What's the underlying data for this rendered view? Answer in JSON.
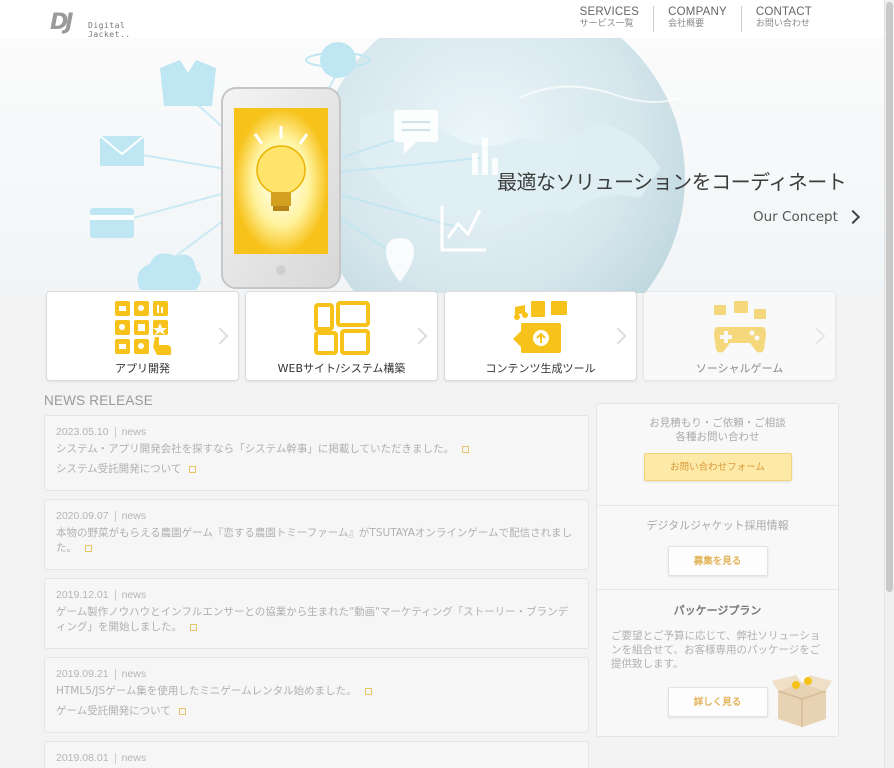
{
  "header": {
    "logo_mark": "DJ",
    "logo_text": "Digital Jacket..",
    "nav": [
      {
        "en": "SERVICES",
        "jp": "サービス一覧"
      },
      {
        "en": "COMPANY",
        "jp": "会社概要"
      },
      {
        "en": "CONTACT",
        "jp": "お問い合わせ"
      }
    ]
  },
  "hero": {
    "tagline": "最適なソリューションをコーディネート",
    "concept_link": "Our Concept"
  },
  "services": [
    {
      "label": "アプリ開発",
      "icon": "apps-grid-icon"
    },
    {
      "label": "WEBサイト/システム構築",
      "icon": "devices-icon"
    },
    {
      "label": "コンテンツ生成ツール",
      "icon": "content-tools-icon"
    },
    {
      "label": "ソーシャルゲーム",
      "icon": "gamepad-icon"
    }
  ],
  "news": {
    "title": "NEWS RELEASE",
    "items": [
      {
        "date": "2023.05.10",
        "category": "news",
        "links": [
          "システム・アプリ開発会社を探すなら「システム幹事」に掲載していただきました。",
          "システム受託開発について"
        ]
      },
      {
        "date": "2020.09.07",
        "category": "news",
        "links": [
          "本物の野菜がもらえる農園ゲーム『恋する農園トミーファーム』がTSUTAYAオンラインゲームで配信されました。"
        ]
      },
      {
        "date": "2019.12.01",
        "category": "news",
        "links": [
          "ゲーム製作ノウハウとインフルエンサーとの協業から生まれた\"動画\"マーケティング「ストーリー・ブランディング」を開始しました。"
        ]
      },
      {
        "date": "2019.09.21",
        "category": "news",
        "links": [
          "HTML5/JSゲーム集を使用したミニゲームレンタル始めました。",
          "ゲーム受託開発について"
        ]
      },
      {
        "date": "2019.08.01",
        "category": "news",
        "links": []
      }
    ]
  },
  "sidebar": {
    "contact_text_1": "お見積もり・ご依頼・ご相談",
    "contact_text_2": "各種お問い合わせ",
    "contact_button": "お問い合わせフォーム",
    "recruit_text": "デジタルジャケット採用情報",
    "recruit_button": "募集を見る",
    "package_heading": "パッケージプラン",
    "package_text": "ご要望とご予算に応じて、弊社ソリューションを組合せて、お客様専用のパッケージをご提供致します。",
    "package_button": "詳しく見る"
  },
  "colors": {
    "accent_gold": "#f5b800",
    "card_icon": "#f7c21a",
    "hero_blue": "#bfe6f3"
  }
}
